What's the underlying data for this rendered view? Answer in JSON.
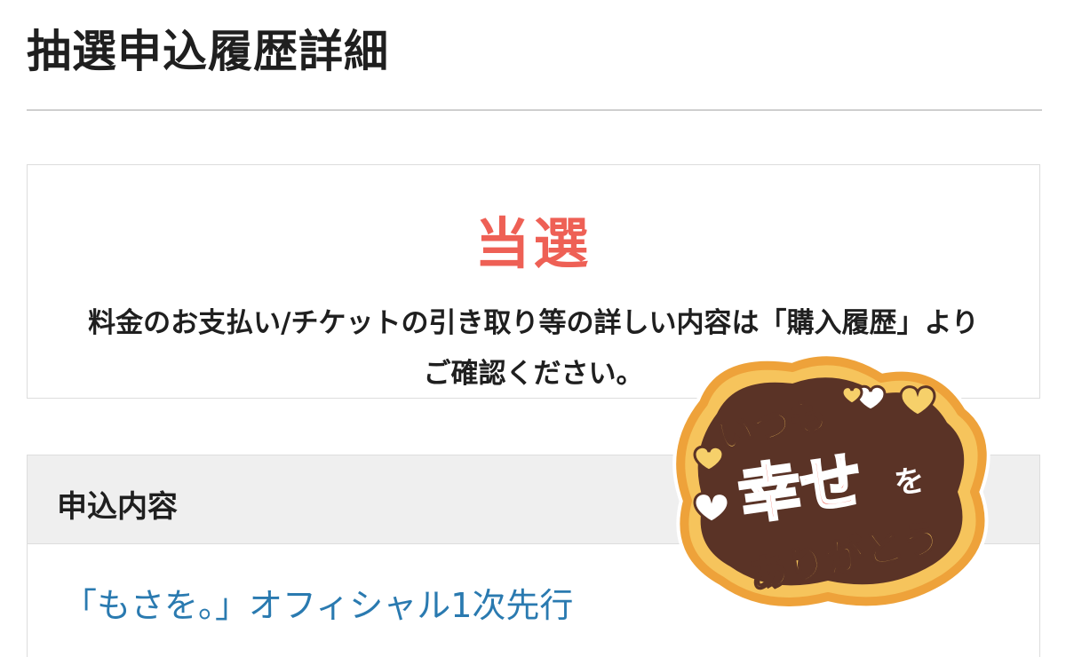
{
  "page": {
    "title": "抽選申込履歴詳細"
  },
  "result": {
    "status": "当選",
    "message_line1": "料金のお支払い/チケットの引き取り等の詳しい内容は「購入履歴」より",
    "message_line2": "ご確認ください。",
    "status_color": "#ee6055"
  },
  "details": {
    "header": "申込内容",
    "entry_name": "「もさを。」オフィシャル1次先行",
    "link_color": "#2a7ab0"
  },
  "sticker": {
    "line1": "いつも",
    "line2_main": "幸せ",
    "line2_suffix": "を",
    "line3": "ありがとう",
    "icons": [
      "heart-icon"
    ]
  }
}
